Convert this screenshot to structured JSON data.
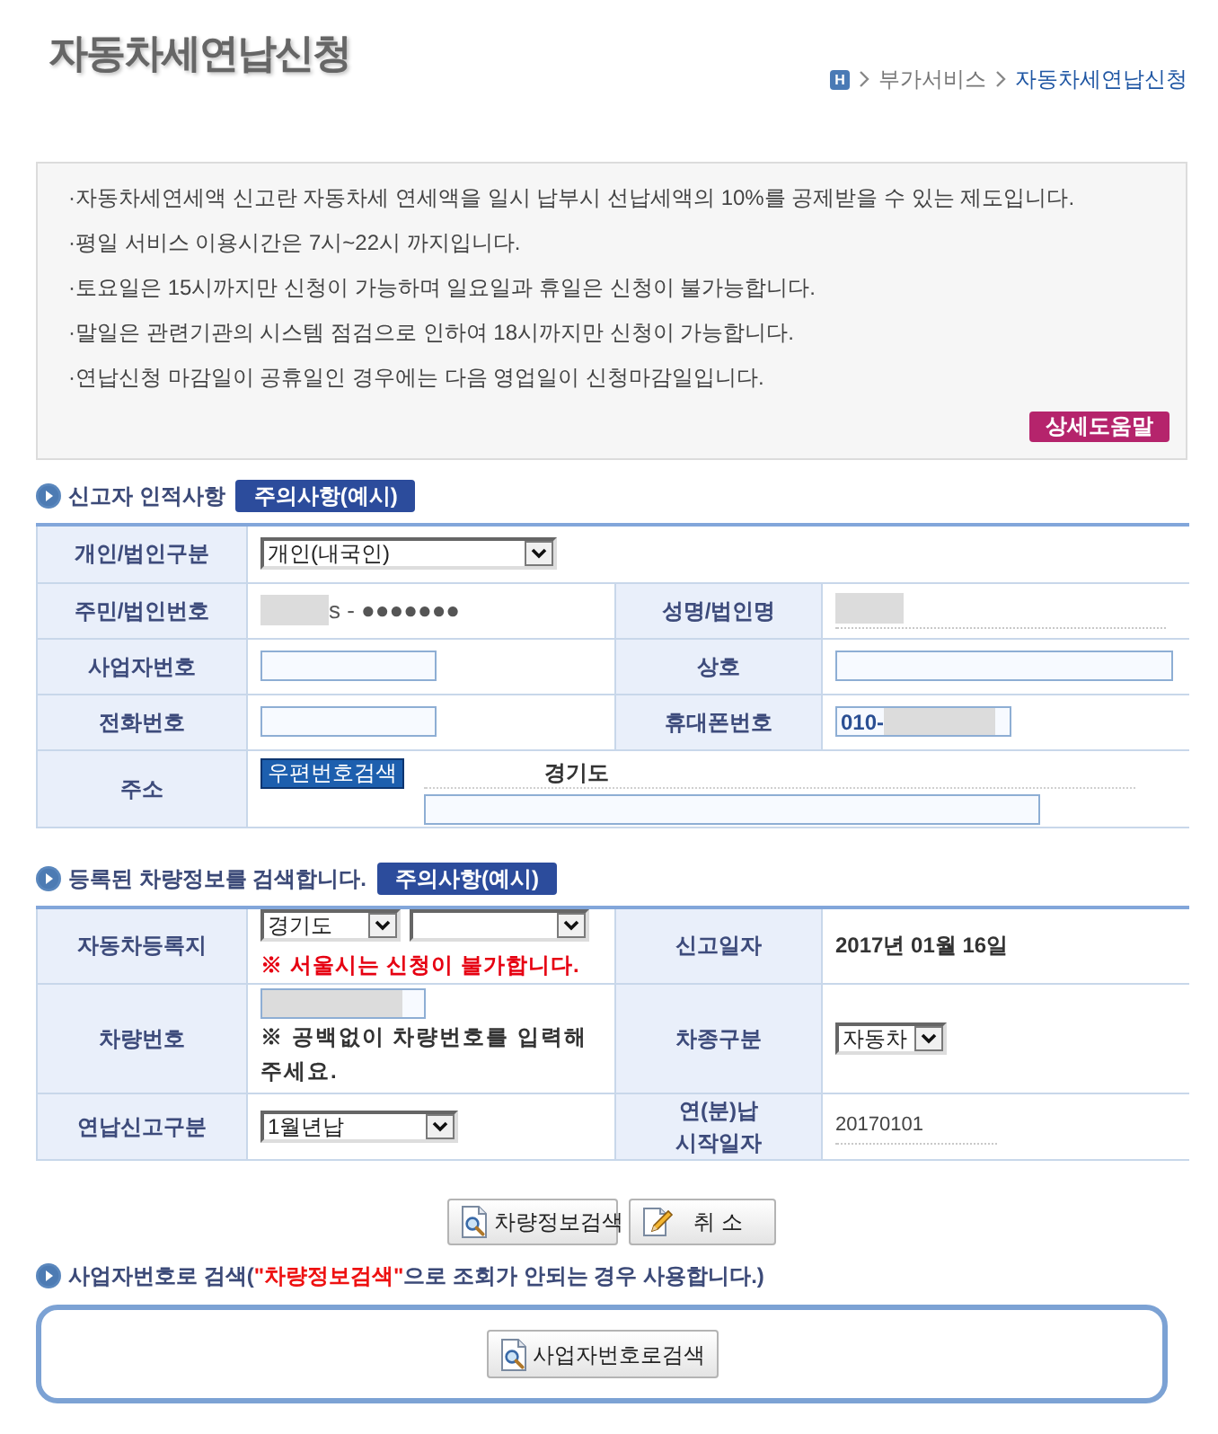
{
  "page": {
    "title": "자동차세연납신청"
  },
  "breadcrumb": {
    "home": "H",
    "items": [
      {
        "label": "부가서비스",
        "current": false
      },
      {
        "label": "자동차세연납신청",
        "current": true
      }
    ]
  },
  "notice": {
    "items": [
      "·자동차세연세액 신고란 자동차세 연세액을 일시 납부시 선납세액의 10%를 공제받을 수 있는 제도입니다.",
      "·평일 서비스 이용시간은 7시~22시 까지입니다.",
      "·토요일은 15시까지만 신청이 가능하며 일요일과 휴일은 신청이 불가능합니다.",
      "·말일은 관련기관의 시스템 점검으로 인하여 18시까지만 신청이 가능합니다.",
      "·연납신청 마감일이 공휴일인 경우에는 다음 영업일이 신청마감일입니다."
    ],
    "help_button": "상세도움말"
  },
  "reporter_section": {
    "heading": "신고자 인적사항",
    "badge": "주의사항(예시)",
    "rows": [
      {
        "cells": [
          {
            "label": "개인/법인구분",
            "field": {
              "kind": "select",
              "value": "개인(내국인)"
            }
          }
        ]
      },
      {
        "cells": [
          {
            "label": "주민/법인번호",
            "field": {
              "kind": "static",
              "masked": true,
              "value": "s - ●●●●●●●",
              "underline": false
            }
          },
          {
            "label": "성명/법인명",
            "field": {
              "kind": "static",
              "masked": true,
              "underline": true
            }
          }
        ]
      },
      {
        "cells": [
          {
            "label": "사업자번호",
            "field": {
              "kind": "input",
              "masked": false
            }
          },
          {
            "label": "상호",
            "field": {
              "kind": "long_input",
              "masked": false
            }
          }
        ]
      },
      {
        "cells": [
          {
            "label": "전화번호",
            "field": {
              "kind": "input",
              "masked": false
            }
          },
          {
            "label": "휴대폰번호",
            "field": {
              "kind": "input",
              "value": "010-",
              "masked": true
            }
          }
        ]
      },
      {
        "cells": [
          {
            "label": "주소",
            "field": {
              "kind": "address",
              "button": "우편번호검색",
              "value": "경기도"
            }
          }
        ]
      }
    ]
  },
  "vehicle_section": {
    "heading": "등록된 차량정보를 검색합니다.",
    "badge": "주의사항(예시)",
    "rows": [
      {
        "cells": [
          {
            "label": "자동차등록지",
            "field": {
              "kind": "region",
              "value": "경기도",
              "note": "※ 서울시는 신청이 불가합니다."
            }
          },
          {
            "label": "신고일자",
            "field": {
              "kind": "text",
              "value": "2017년 01월 16일"
            }
          }
        ]
      },
      {
        "cells": [
          {
            "label": "차량번호",
            "field": {
              "kind": "input_note",
              "masked": true,
              "note": "※ 공백없이 차량번호를 입력해 주세요."
            }
          },
          {
            "label": "차종구분",
            "field": {
              "kind": "select",
              "value": "자동차"
            }
          }
        ]
      },
      {
        "cells": [
          {
            "label": "연납신고구분",
            "field": {
              "kind": "select",
              "value": "1월년납"
            }
          },
          {
            "label": "연(분)납\n시작일자",
            "field": {
              "kind": "static",
              "masked": false,
              "value": "20170101",
              "underline": true
            }
          }
        ]
      }
    ]
  },
  "actions": [
    {
      "kind": "search",
      "label": "차량정보검색"
    },
    {
      "kind": "cancel",
      "label": "취 소"
    }
  ],
  "business_search": {
    "heading": "사업자번호로 검색(**\"차량정보검색\"**으로 조회가 안되는 경우 사용합니다.)",
    "button": "사업자번호로검색"
  }
}
